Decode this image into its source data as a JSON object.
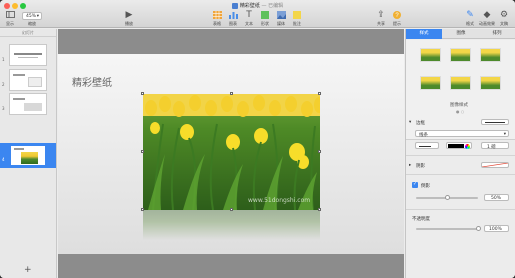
{
  "window": {
    "title": "精彩壁纸",
    "subtitle": "— 已编辑"
  },
  "toolbar": {
    "view_label": "显示",
    "zoom_label": "缩放",
    "zoom_value": "45%",
    "play_label": "播放",
    "table_label": "表格",
    "chart_label": "图表",
    "text_label": "文本",
    "shape_label": "形状",
    "media_label": "媒体",
    "comment_label": "批注",
    "share_label": "共享",
    "tips_label": "提示",
    "format_label": "格式",
    "animate_label": "动画效果",
    "document_label": "文稿"
  },
  "sidebar": {
    "header": "幻灯片",
    "slides": [
      {
        "num": "1"
      },
      {
        "num": "2"
      },
      {
        "num": "3"
      },
      {
        "num": "4"
      }
    ],
    "add_label": "+"
  },
  "slide": {
    "title": "精彩壁纸",
    "watermark": "www.51dongshi.com"
  },
  "inspector": {
    "tabs": [
      "样式",
      "图像",
      "排列"
    ],
    "style_caption": "图像样式",
    "border_label": "边框",
    "border_type": "线条",
    "border_width": "1 磅",
    "shadow_label": "阴影",
    "reflection_label": "倒影",
    "reflection_value": "50%",
    "opacity_label": "不透明度",
    "opacity_value": "100%",
    "reflection_fraction": 0.5,
    "opacity_fraction": 1.0
  },
  "colors": {
    "accent": "#3b86f0",
    "border_color": "#000000"
  }
}
